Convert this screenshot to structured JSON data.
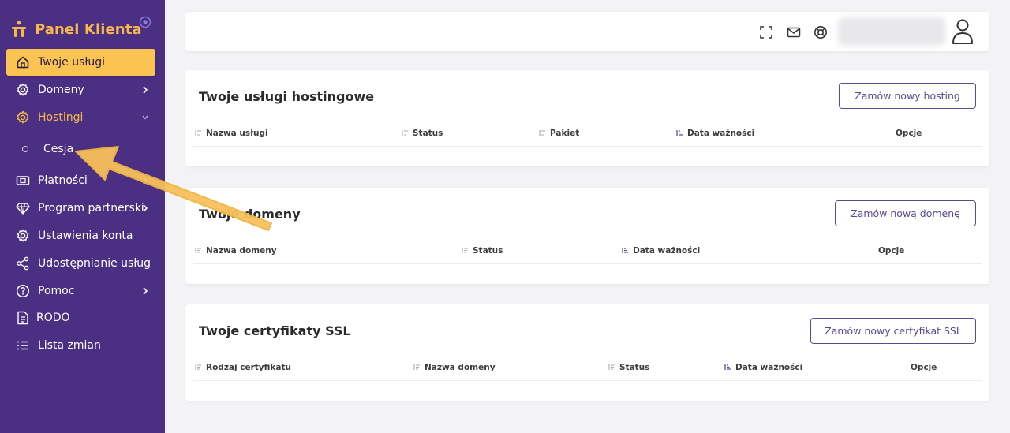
{
  "sidebar": {
    "brand_title": "Panel Klienta",
    "items": [
      {
        "label": "Twoje usługi",
        "icon": "home-icon"
      },
      {
        "label": "Domeny",
        "icon": "gear-icon"
      },
      {
        "label": "Hostingi",
        "icon": "gear-icon"
      },
      {
        "label": "Cesja",
        "icon": "circle-icon"
      },
      {
        "label": "Płatności",
        "icon": "money-icon"
      },
      {
        "label": "Program partnerski",
        "icon": "diamond-icon"
      },
      {
        "label": "Ustawienia konta",
        "icon": "gear-icon"
      },
      {
        "label": "Udostępnianie usług",
        "icon": "share-icon"
      },
      {
        "label": "Pomoc",
        "icon": "help-icon"
      },
      {
        "label": "RODO",
        "icon": "document-icon"
      },
      {
        "label": "Lista zmian",
        "icon": "list-icon"
      }
    ]
  },
  "topbar": {
    "icons": [
      "fullscreen-icon",
      "mail-icon",
      "support-icon",
      "user-icon"
    ]
  },
  "hosting": {
    "title": "Twoje usługi hostingowe",
    "button": "Zamów nowy hosting",
    "columns": [
      "Nazwa usługi",
      "Status",
      "Pakiet",
      "Data ważności",
      "Opcje"
    ]
  },
  "domains": {
    "title": "Twoje domeny",
    "button": "Zamów nową domenę",
    "columns": [
      "Nazwa domeny",
      "Status",
      "Data ważności",
      "Opcje"
    ]
  },
  "ssl": {
    "title": "Twoje certyfikaty SSL",
    "button": "Zamów nowy certyfikat SSL",
    "columns": [
      "Rodzaj certyfikatu",
      "Nazwa domeny",
      "Status",
      "Data ważności",
      "Opcje"
    ]
  },
  "colors": {
    "sidebar_bg": "#4b2f82",
    "accent": "#fbc352",
    "button_border": "#5c4a96"
  }
}
